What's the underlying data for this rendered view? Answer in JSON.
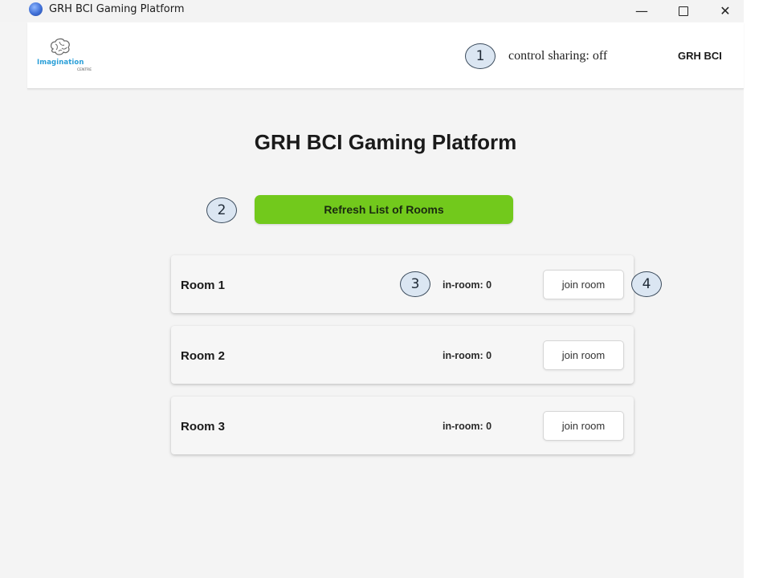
{
  "window": {
    "title": "GRH BCI Gaming Platform",
    "minimize_symbol": "—",
    "close_symbol": "✕"
  },
  "header": {
    "logo": {
      "wordmark": "Imagination",
      "subtext": "CENTRE",
      "icon": "brain-icon"
    },
    "control_sharing": "control sharing: off",
    "user": "GRH BCI"
  },
  "main": {
    "title": "GRH BCI Gaming Platform",
    "refresh_label": "Refresh List of Rooms",
    "refresh_color": "#72c91c",
    "rooms": [
      {
        "name": "Room 1",
        "count": "in-room: 0",
        "join_label": "join room"
      },
      {
        "name": "Room 2",
        "count": "in-room: 0",
        "join_label": "join room"
      },
      {
        "name": "Room 3",
        "count": "in-room: 0",
        "join_label": "join room"
      }
    ]
  },
  "callouts": [
    "1",
    "2",
    "3",
    "4"
  ]
}
